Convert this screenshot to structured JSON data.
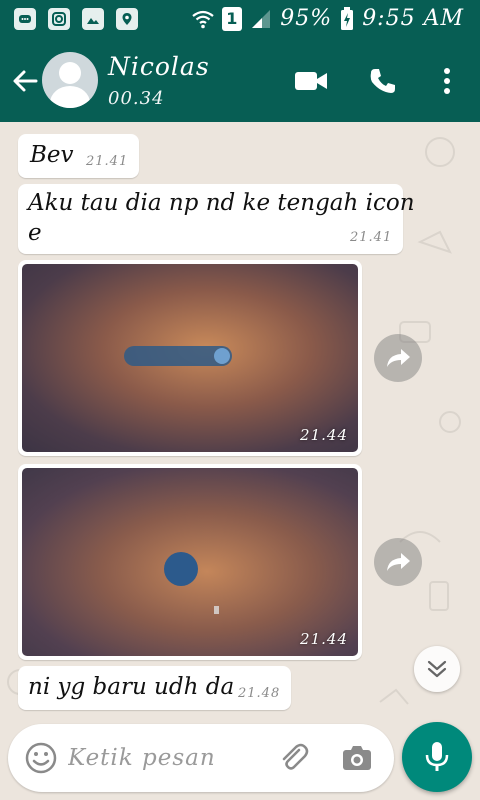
{
  "status_bar": {
    "battery_percent": "95%",
    "time": "9:55 AM",
    "sim_slot": "1",
    "notification_icons": [
      "chat-icon",
      "instagram-icon",
      "image-icon",
      "location-icon"
    ]
  },
  "header": {
    "contact_name": "Nicolas",
    "contact_status": "00.34",
    "actions": [
      "video-call-icon",
      "voice-call-icon",
      "more-options-icon"
    ]
  },
  "messages": [
    {
      "type": "text",
      "text": "Bev",
      "time": "21.41"
    },
    {
      "type": "text",
      "text_lines": [
        "Aku tau dia np nd ke tengah icon",
        "e"
      ],
      "time": "21.41"
    },
    {
      "type": "image",
      "time": "21.44"
    },
    {
      "type": "image",
      "time": "21.44"
    },
    {
      "type": "text",
      "text": "ni yg baru udh da",
      "time": "21.48"
    }
  ],
  "composer": {
    "placeholder": "Ketik pesan"
  },
  "colors": {
    "header": "#075E54",
    "chat_background": "#ECE5DD",
    "mic_button": "#00897B"
  }
}
